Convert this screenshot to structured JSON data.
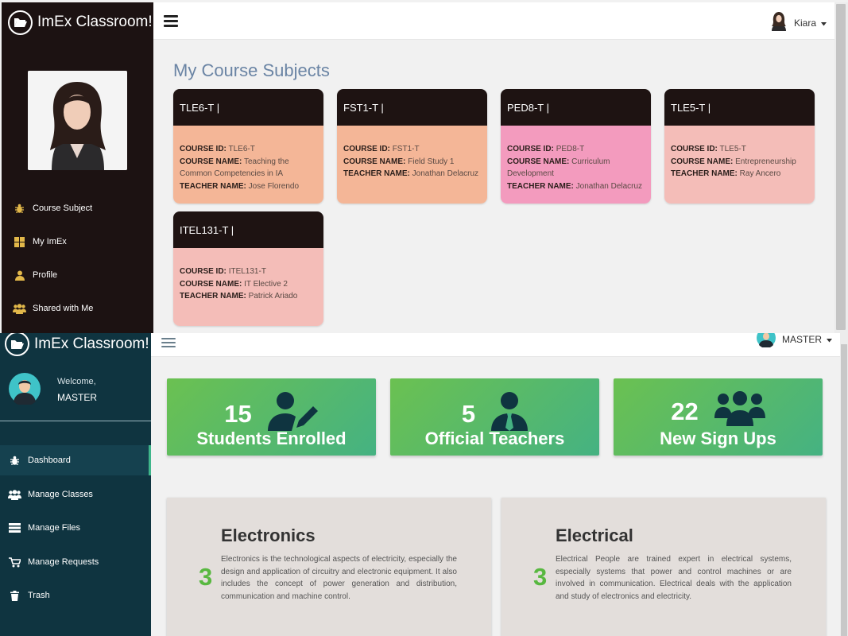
{
  "student": {
    "brand": "ImEx Classroom!",
    "user_name": "Kiara",
    "nav": [
      {
        "label": "Course Subject",
        "icon": "bug-icon"
      },
      {
        "label": "My ImEx",
        "icon": "windows-icon"
      },
      {
        "label": "Profile",
        "icon": "user-icon"
      },
      {
        "label": "Shared with Me",
        "icon": "users-icon"
      }
    ],
    "page_title": "My Course Subjects",
    "labels": {
      "id": "COURSE ID:",
      "name": "COURSE NAME:",
      "teacher": "TEACHER NAME:"
    },
    "courses": [
      {
        "code": "TLE6-T |",
        "id": "TLE6-T",
        "name": "Teaching the Common Competencies in IA",
        "teacher": "Jose Florendo",
        "color": "#f4b697"
      },
      {
        "code": "FST1-T |",
        "id": "FST1-T",
        "name": "Field Study 1",
        "teacher": "Jonathan Delacruz",
        "color": "#f4b697"
      },
      {
        "code": "PED8-T |",
        "id": "PED8-T",
        "name": "Curriculum Development",
        "teacher": "Jonathan Delacruz",
        "color": "#f39bbe"
      },
      {
        "code": "TLE5-T |",
        "id": "TLE5-T",
        "name": "Entrepreneurship",
        "teacher": "Ray Ancero",
        "color": "#f4bdb8"
      },
      {
        "code": "ITEL131-T |",
        "id": "ITEL131-T",
        "name": "IT Elective 2",
        "teacher": "Patrick Ariado",
        "color": "#f4bdb8"
      }
    ]
  },
  "admin": {
    "brand": "ImEx Classroom!",
    "user_name": "MASTER",
    "welcome": "Welcome,",
    "welcome_name": "MASTER",
    "nav": [
      {
        "label": "Dashboard",
        "icon": "bug-icon"
      },
      {
        "label": "Manage Classes",
        "icon": "users-icon"
      },
      {
        "label": "Manage Files",
        "icon": "server-icon"
      },
      {
        "label": "Manage Requests",
        "icon": "cart-icon"
      },
      {
        "label": "Trash",
        "icon": "trash-icon"
      }
    ],
    "stats": [
      {
        "value": "15",
        "label": "Students Enrolled",
        "icon": "user-edit-icon"
      },
      {
        "value": "5",
        "label": "Official Teachers",
        "icon": "user-tie-icon"
      },
      {
        "value": "22",
        "label": "New Sign Ups",
        "icon": "users-icon"
      }
    ],
    "departments": [
      {
        "title": "Electronics",
        "count": "3",
        "desc": "Electronics is the technological aspects of electricity, especially the design and application of circuitry and electronic equipment. It also includes the concept of power generation and distribution, communication and machine control."
      },
      {
        "title": "Electrical",
        "count": "3",
        "desc": "Electrical People are trained expert in electrical systems, especially systems that power and control machines or are involved in communication. Electrical deals with the application and study of electronics and electricity."
      }
    ],
    "colors": {
      "sidebar": "#0f3440",
      "accent": "#3fb58a",
      "stat_start": "#6bc151",
      "stat_end": "#45b282"
    }
  }
}
